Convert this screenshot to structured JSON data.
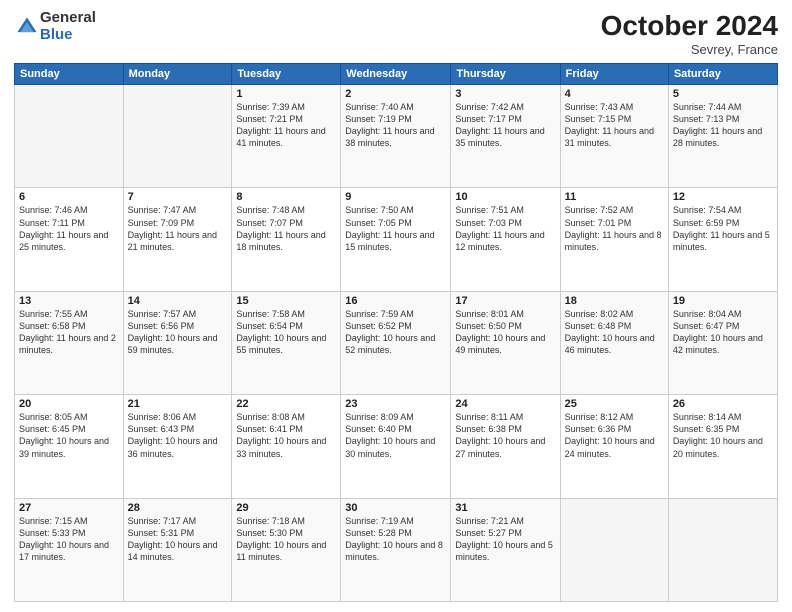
{
  "header": {
    "logo_general": "General",
    "logo_blue": "Blue",
    "month_title": "October 2024",
    "location": "Sevrey, France"
  },
  "weekdays": [
    "Sunday",
    "Monday",
    "Tuesday",
    "Wednesday",
    "Thursday",
    "Friday",
    "Saturday"
  ],
  "weeks": [
    [
      {
        "day": "",
        "sunrise": "",
        "sunset": "",
        "daylight": "",
        "empty": true
      },
      {
        "day": "",
        "sunrise": "",
        "sunset": "",
        "daylight": "",
        "empty": true
      },
      {
        "day": "1",
        "sunrise": "Sunrise: 7:39 AM",
        "sunset": "Sunset: 7:21 PM",
        "daylight": "Daylight: 11 hours and 41 minutes.",
        "empty": false
      },
      {
        "day": "2",
        "sunrise": "Sunrise: 7:40 AM",
        "sunset": "Sunset: 7:19 PM",
        "daylight": "Daylight: 11 hours and 38 minutes.",
        "empty": false
      },
      {
        "day": "3",
        "sunrise": "Sunrise: 7:42 AM",
        "sunset": "Sunset: 7:17 PM",
        "daylight": "Daylight: 11 hours and 35 minutes.",
        "empty": false
      },
      {
        "day": "4",
        "sunrise": "Sunrise: 7:43 AM",
        "sunset": "Sunset: 7:15 PM",
        "daylight": "Daylight: 11 hours and 31 minutes.",
        "empty": false
      },
      {
        "day": "5",
        "sunrise": "Sunrise: 7:44 AM",
        "sunset": "Sunset: 7:13 PM",
        "daylight": "Daylight: 11 hours and 28 minutes.",
        "empty": false
      }
    ],
    [
      {
        "day": "6",
        "sunrise": "Sunrise: 7:46 AM",
        "sunset": "Sunset: 7:11 PM",
        "daylight": "Daylight: 11 hours and 25 minutes.",
        "empty": false
      },
      {
        "day": "7",
        "sunrise": "Sunrise: 7:47 AM",
        "sunset": "Sunset: 7:09 PM",
        "daylight": "Daylight: 11 hours and 21 minutes.",
        "empty": false
      },
      {
        "day": "8",
        "sunrise": "Sunrise: 7:48 AM",
        "sunset": "Sunset: 7:07 PM",
        "daylight": "Daylight: 11 hours and 18 minutes.",
        "empty": false
      },
      {
        "day": "9",
        "sunrise": "Sunrise: 7:50 AM",
        "sunset": "Sunset: 7:05 PM",
        "daylight": "Daylight: 11 hours and 15 minutes.",
        "empty": false
      },
      {
        "day": "10",
        "sunrise": "Sunrise: 7:51 AM",
        "sunset": "Sunset: 7:03 PM",
        "daylight": "Daylight: 11 hours and 12 minutes.",
        "empty": false
      },
      {
        "day": "11",
        "sunrise": "Sunrise: 7:52 AM",
        "sunset": "Sunset: 7:01 PM",
        "daylight": "Daylight: 11 hours and 8 minutes.",
        "empty": false
      },
      {
        "day": "12",
        "sunrise": "Sunrise: 7:54 AM",
        "sunset": "Sunset: 6:59 PM",
        "daylight": "Daylight: 11 hours and 5 minutes.",
        "empty": false
      }
    ],
    [
      {
        "day": "13",
        "sunrise": "Sunrise: 7:55 AM",
        "sunset": "Sunset: 6:58 PM",
        "daylight": "Daylight: 11 hours and 2 minutes.",
        "empty": false
      },
      {
        "day": "14",
        "sunrise": "Sunrise: 7:57 AM",
        "sunset": "Sunset: 6:56 PM",
        "daylight": "Daylight: 10 hours and 59 minutes.",
        "empty": false
      },
      {
        "day": "15",
        "sunrise": "Sunrise: 7:58 AM",
        "sunset": "Sunset: 6:54 PM",
        "daylight": "Daylight: 10 hours and 55 minutes.",
        "empty": false
      },
      {
        "day": "16",
        "sunrise": "Sunrise: 7:59 AM",
        "sunset": "Sunset: 6:52 PM",
        "daylight": "Daylight: 10 hours and 52 minutes.",
        "empty": false
      },
      {
        "day": "17",
        "sunrise": "Sunrise: 8:01 AM",
        "sunset": "Sunset: 6:50 PM",
        "daylight": "Daylight: 10 hours and 49 minutes.",
        "empty": false
      },
      {
        "day": "18",
        "sunrise": "Sunrise: 8:02 AM",
        "sunset": "Sunset: 6:48 PM",
        "daylight": "Daylight: 10 hours and 46 minutes.",
        "empty": false
      },
      {
        "day": "19",
        "sunrise": "Sunrise: 8:04 AM",
        "sunset": "Sunset: 6:47 PM",
        "daylight": "Daylight: 10 hours and 42 minutes.",
        "empty": false
      }
    ],
    [
      {
        "day": "20",
        "sunrise": "Sunrise: 8:05 AM",
        "sunset": "Sunset: 6:45 PM",
        "daylight": "Daylight: 10 hours and 39 minutes.",
        "empty": false
      },
      {
        "day": "21",
        "sunrise": "Sunrise: 8:06 AM",
        "sunset": "Sunset: 6:43 PM",
        "daylight": "Daylight: 10 hours and 36 minutes.",
        "empty": false
      },
      {
        "day": "22",
        "sunrise": "Sunrise: 8:08 AM",
        "sunset": "Sunset: 6:41 PM",
        "daylight": "Daylight: 10 hours and 33 minutes.",
        "empty": false
      },
      {
        "day": "23",
        "sunrise": "Sunrise: 8:09 AM",
        "sunset": "Sunset: 6:40 PM",
        "daylight": "Daylight: 10 hours and 30 minutes.",
        "empty": false
      },
      {
        "day": "24",
        "sunrise": "Sunrise: 8:11 AM",
        "sunset": "Sunset: 6:38 PM",
        "daylight": "Daylight: 10 hours and 27 minutes.",
        "empty": false
      },
      {
        "day": "25",
        "sunrise": "Sunrise: 8:12 AM",
        "sunset": "Sunset: 6:36 PM",
        "daylight": "Daylight: 10 hours and 24 minutes.",
        "empty": false
      },
      {
        "day": "26",
        "sunrise": "Sunrise: 8:14 AM",
        "sunset": "Sunset: 6:35 PM",
        "daylight": "Daylight: 10 hours and 20 minutes.",
        "empty": false
      }
    ],
    [
      {
        "day": "27",
        "sunrise": "Sunrise: 7:15 AM",
        "sunset": "Sunset: 5:33 PM",
        "daylight": "Daylight: 10 hours and 17 minutes.",
        "empty": false
      },
      {
        "day": "28",
        "sunrise": "Sunrise: 7:17 AM",
        "sunset": "Sunset: 5:31 PM",
        "daylight": "Daylight: 10 hours and 14 minutes.",
        "empty": false
      },
      {
        "day": "29",
        "sunrise": "Sunrise: 7:18 AM",
        "sunset": "Sunset: 5:30 PM",
        "daylight": "Daylight: 10 hours and 11 minutes.",
        "empty": false
      },
      {
        "day": "30",
        "sunrise": "Sunrise: 7:19 AM",
        "sunset": "Sunset: 5:28 PM",
        "daylight": "Daylight: 10 hours and 8 minutes.",
        "empty": false
      },
      {
        "day": "31",
        "sunrise": "Sunrise: 7:21 AM",
        "sunset": "Sunset: 5:27 PM",
        "daylight": "Daylight: 10 hours and 5 minutes.",
        "empty": false
      },
      {
        "day": "",
        "sunrise": "",
        "sunset": "",
        "daylight": "",
        "empty": true
      },
      {
        "day": "",
        "sunrise": "",
        "sunset": "",
        "daylight": "",
        "empty": true
      }
    ]
  ]
}
